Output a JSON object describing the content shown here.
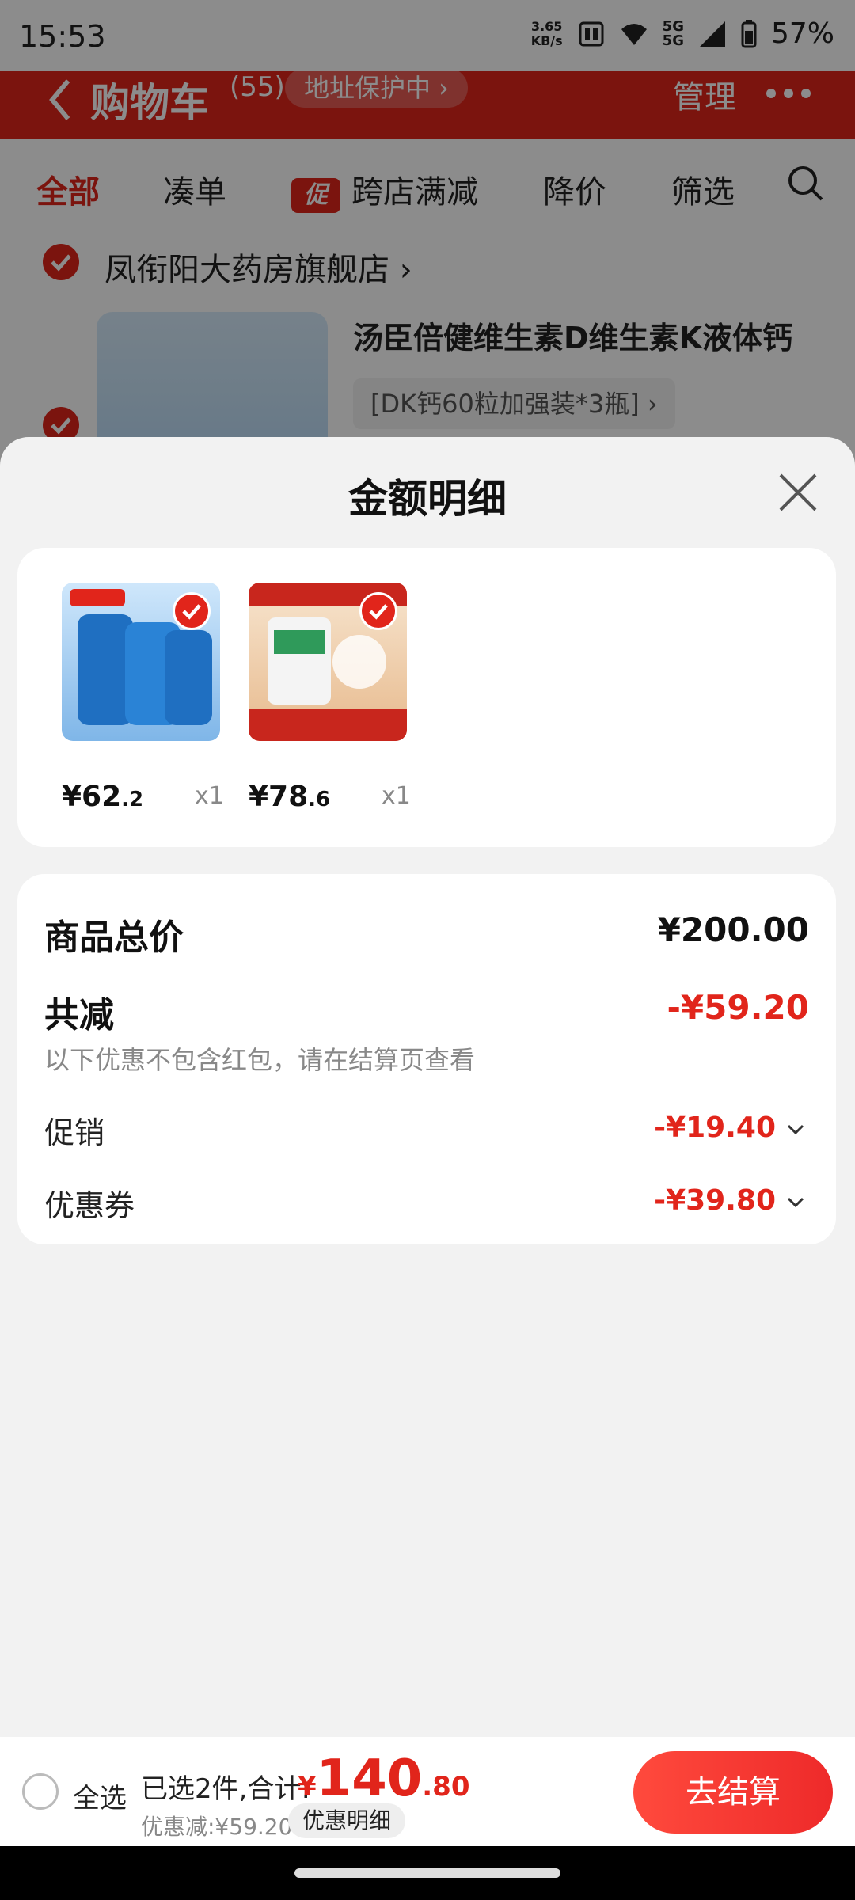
{
  "status_bar": {
    "time": "15:53",
    "net_speed_value": "3.65",
    "net_speed_unit": "KB/s",
    "signal_label_top": "5G",
    "signal_label_bottom": "5G",
    "battery": "57%"
  },
  "cart_header": {
    "title": "购物车",
    "count": "(55)",
    "address_pill": "地址保护中 ›",
    "manage_label": "管理"
  },
  "filter_bar": {
    "items": [
      "全部",
      "凑单",
      "跨店满减",
      "降价",
      "筛选"
    ],
    "promo_tag": "促"
  },
  "store": {
    "name": "凤衔阳大药房旗舰店 ›",
    "product_title": "汤臣倍健维生素D维生素K液体钙",
    "product_spec": "[DK钙60粒加强装*3瓶] ›"
  },
  "sheet": {
    "title": "金额明细",
    "items": [
      {
        "price_int": "¥62",
        "price_dec": ".2",
        "qty": "x1"
      },
      {
        "price_int": "¥78",
        "price_dec": ".6",
        "qty": "x1"
      }
    ],
    "summary": {
      "total_label": "商品总价",
      "total_value": "¥200.00",
      "reduce_label": "共减",
      "reduce_value": "-¥59.20",
      "note": "以下优惠不包含红包，请在结算页查看",
      "rows": [
        {
          "label": "促销",
          "value": "-¥19.40"
        },
        {
          "label": "优惠券",
          "value": "-¥39.80"
        }
      ]
    }
  },
  "bottom_bar": {
    "select_all": "全选",
    "selected_text": "已选2件,合计:",
    "currency": "¥",
    "total_int": "140",
    "total_dec": ".80",
    "discount_text": "优惠减:¥59.20",
    "detail_chip": "优惠明细",
    "checkout_label": "去结算"
  },
  "colors": {
    "accent": "#e1251b",
    "price_red": "#e1251b",
    "sheet_bg": "#f2f2f2"
  }
}
